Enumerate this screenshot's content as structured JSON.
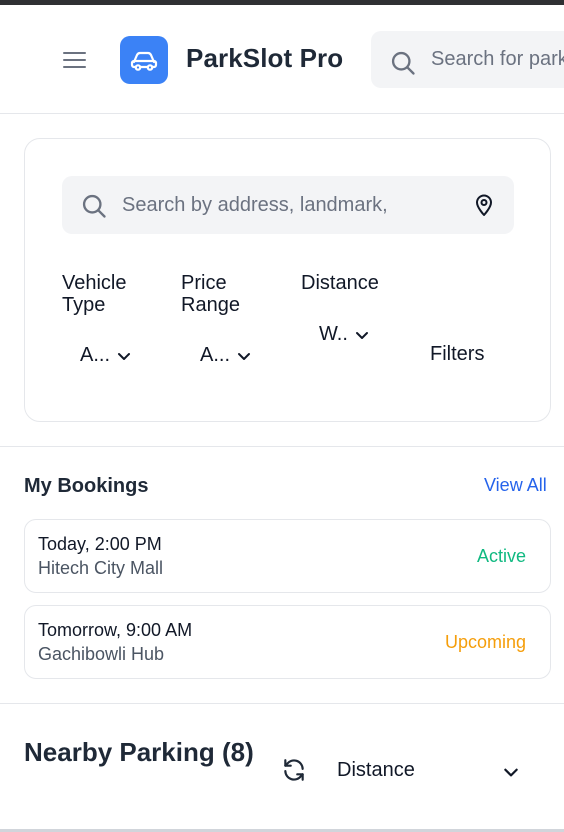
{
  "app": {
    "name": "ParkSlot Pro",
    "accent_color": "#3b82f6"
  },
  "header": {
    "search_placeholder": "Search for parking"
  },
  "filters": {
    "search_placeholder": "Search by address, landmark,",
    "vehicle_type": {
      "label": "Vehicle Type",
      "value": "A..."
    },
    "price_range": {
      "label": "Price Range",
      "value": "A..."
    },
    "distance": {
      "label": "Distance",
      "value": "W.."
    },
    "filters_button": "Filters"
  },
  "bookings": {
    "title": "My Bookings",
    "view_all": "View All",
    "items": [
      {
        "time": "Today, 2:00 PM",
        "place": "Hitech City Mall",
        "status": "Active",
        "status_color": "#10b981"
      },
      {
        "time": "Tomorrow, 9:00 AM",
        "place": "Gachibowli Hub",
        "status": "Upcoming",
        "status_color": "#f59e0b"
      }
    ]
  },
  "nearby": {
    "title": "Nearby Parking (8)",
    "sort_value": "Distance"
  },
  "icons": {
    "menu": "hamburger-icon",
    "logo": "car-icon",
    "search": "search-icon",
    "location": "map-pin-icon",
    "chevron": "chevron-down-icon",
    "refresh": "refresh-icon"
  }
}
